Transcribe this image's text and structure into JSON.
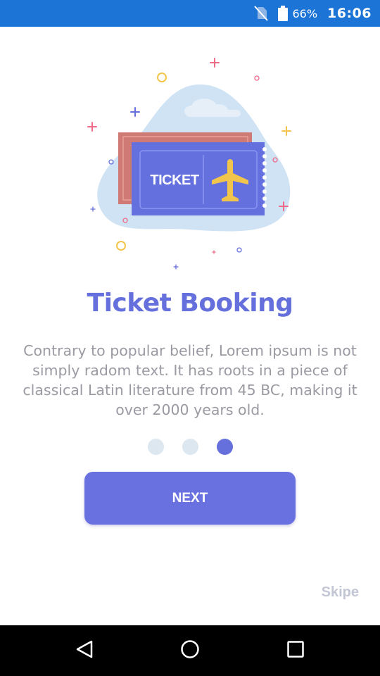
{
  "status_bar": {
    "battery_percent": "66%",
    "time": "16:06",
    "icons": [
      "no-sim-icon",
      "battery-icon"
    ],
    "background_color": "#1c74d6"
  },
  "illustration": {
    "ticket_label": "TICKET",
    "icon": "airplane-icon"
  },
  "onboarding": {
    "title": "Ticket Booking",
    "description": "Contrary to popular belief, Lorem ipsum is not simply radom text. It has roots in a piece of classical Latin literature from 45 BC, making it over 2000 years old.",
    "page_count": 3,
    "current_page": 3,
    "next_label": "NEXT",
    "skip_label": "Skipe",
    "accent_color": "#6970e0"
  },
  "nav_bar": {
    "buttons": [
      "back-icon",
      "home-icon",
      "recents-icon"
    ]
  }
}
